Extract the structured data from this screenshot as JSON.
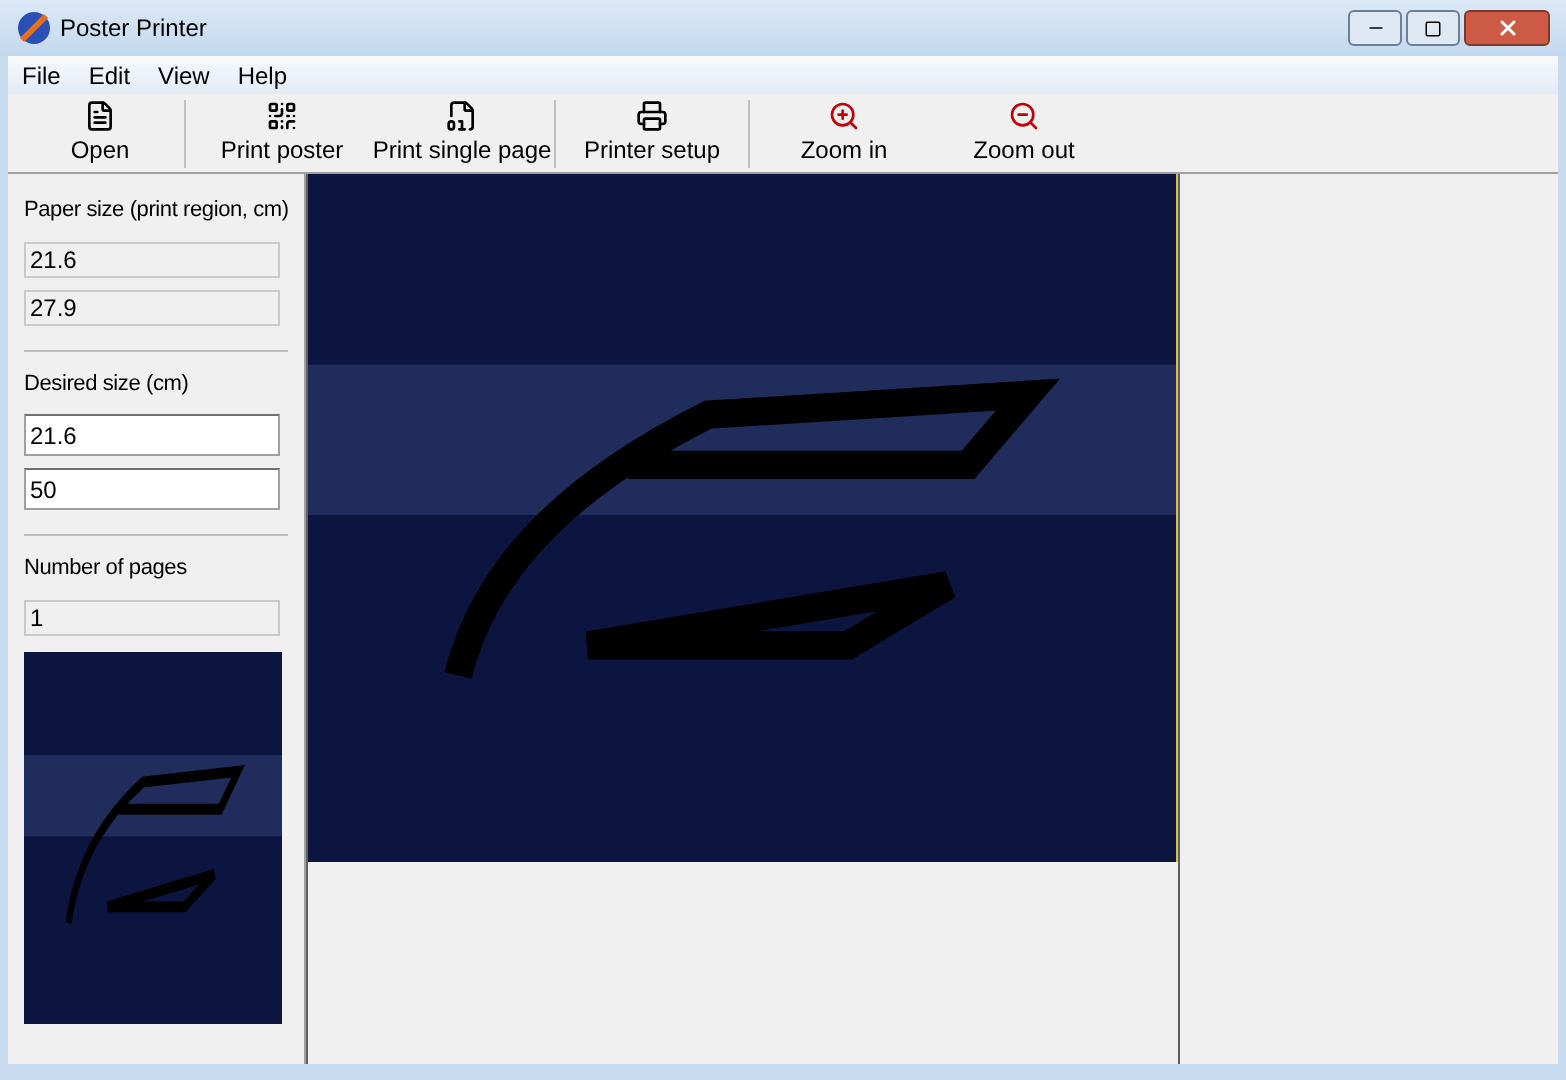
{
  "window": {
    "title": "Poster Printer"
  },
  "menu": [
    "File",
    "Edit",
    "View",
    "Help"
  ],
  "toolbar": [
    {
      "kind": "open",
      "label": "Open"
    },
    {
      "kind": "poster",
      "label": "Print poster"
    },
    {
      "kind": "page",
      "label": "Print single page"
    },
    {
      "kind": "printer",
      "label": "Printer setup"
    },
    {
      "kind": "zoomin",
      "label": "Zoom in"
    },
    {
      "kind": "zoomout",
      "label": "Zoom out"
    }
  ],
  "sidebar": {
    "sections": [
      {
        "title": "Paper size (print region, cm)",
        "fields": [
          {
            "value": "21.6",
            "readonly": true
          },
          {
            "value": "27.9",
            "readonly": true
          }
        ]
      },
      {
        "title": "Desired size (cm)",
        "fields": [
          {
            "value": "21.6",
            "readonly": false
          },
          {
            "value": "50",
            "readonly": false
          }
        ]
      },
      {
        "title": "Number of pages",
        "fields": [
          {
            "value": "1",
            "readonly": true
          }
        ]
      }
    ]
  }
}
